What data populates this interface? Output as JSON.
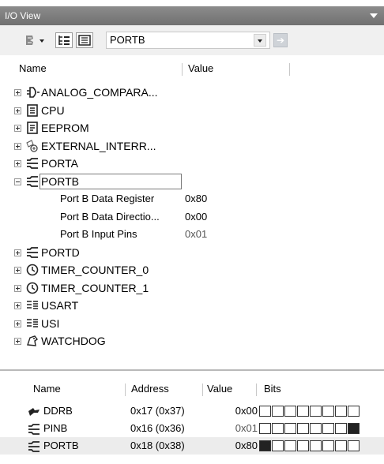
{
  "window": {
    "title": "I/O View"
  },
  "toolbar": {
    "selected_module": "PORTB",
    "go_label": "➔"
  },
  "tree_header": {
    "name": "Name",
    "value": "Value"
  },
  "tree": [
    {
      "name": "ANALOG_COMPARA...",
      "icon": "analog-comparator-icon",
      "expanded": false
    },
    {
      "name": "CPU",
      "icon": "cpu-icon",
      "expanded": false
    },
    {
      "name": "EEPROM",
      "icon": "eeprom-icon",
      "expanded": false
    },
    {
      "name": "EXTERNAL_INTERR...",
      "icon": "external-interrupt-icon",
      "expanded": false
    },
    {
      "name": "PORTA",
      "icon": "port-icon",
      "expanded": false
    },
    {
      "name": "PORTB",
      "icon": "port-icon",
      "expanded": true,
      "selected": true,
      "children": [
        {
          "name": "Port B Data Register",
          "value": "0x80"
        },
        {
          "name": "Port B Data Directio...",
          "value": "0x00"
        },
        {
          "name": "Port B Input Pins",
          "value": "0x01"
        }
      ]
    },
    {
      "name": "PORTD",
      "icon": "port-icon",
      "expanded": false
    },
    {
      "name": "TIMER_COUNTER_0",
      "icon": "timer-icon",
      "expanded": false
    },
    {
      "name": "TIMER_COUNTER_1",
      "icon": "timer-icon",
      "expanded": false
    },
    {
      "name": "USART",
      "icon": "usart-icon",
      "expanded": false
    },
    {
      "name": "USI",
      "icon": "usi-icon",
      "expanded": false
    },
    {
      "name": "WATCHDOG",
      "icon": "watchdog-icon",
      "expanded": false
    }
  ],
  "register_list": {
    "columns": [
      "Name",
      "Address",
      "Value",
      "Bits"
    ],
    "rows": [
      {
        "name": "DDRB",
        "address": "0x17 (0x37)",
        "value": "0x00",
        "bits": [
          0,
          0,
          0,
          0,
          0,
          0,
          0,
          0
        ],
        "icon": "pin-icon"
      },
      {
        "name": "PINB",
        "address": "0x16 (0x36)",
        "value": "0x01",
        "bits": [
          0,
          0,
          0,
          0,
          0,
          0,
          0,
          1
        ],
        "icon": "port-icon"
      },
      {
        "name": "PORTB",
        "address": "0x18 (0x38)",
        "value": "0x80",
        "bits": [
          1,
          0,
          0,
          0,
          0,
          0,
          0,
          0
        ],
        "icon": "port-icon"
      }
    ]
  },
  "colors": {
    "title_bar": "#7a7a7a",
    "selected_row": "#ececec",
    "bit_on": "#222222"
  }
}
